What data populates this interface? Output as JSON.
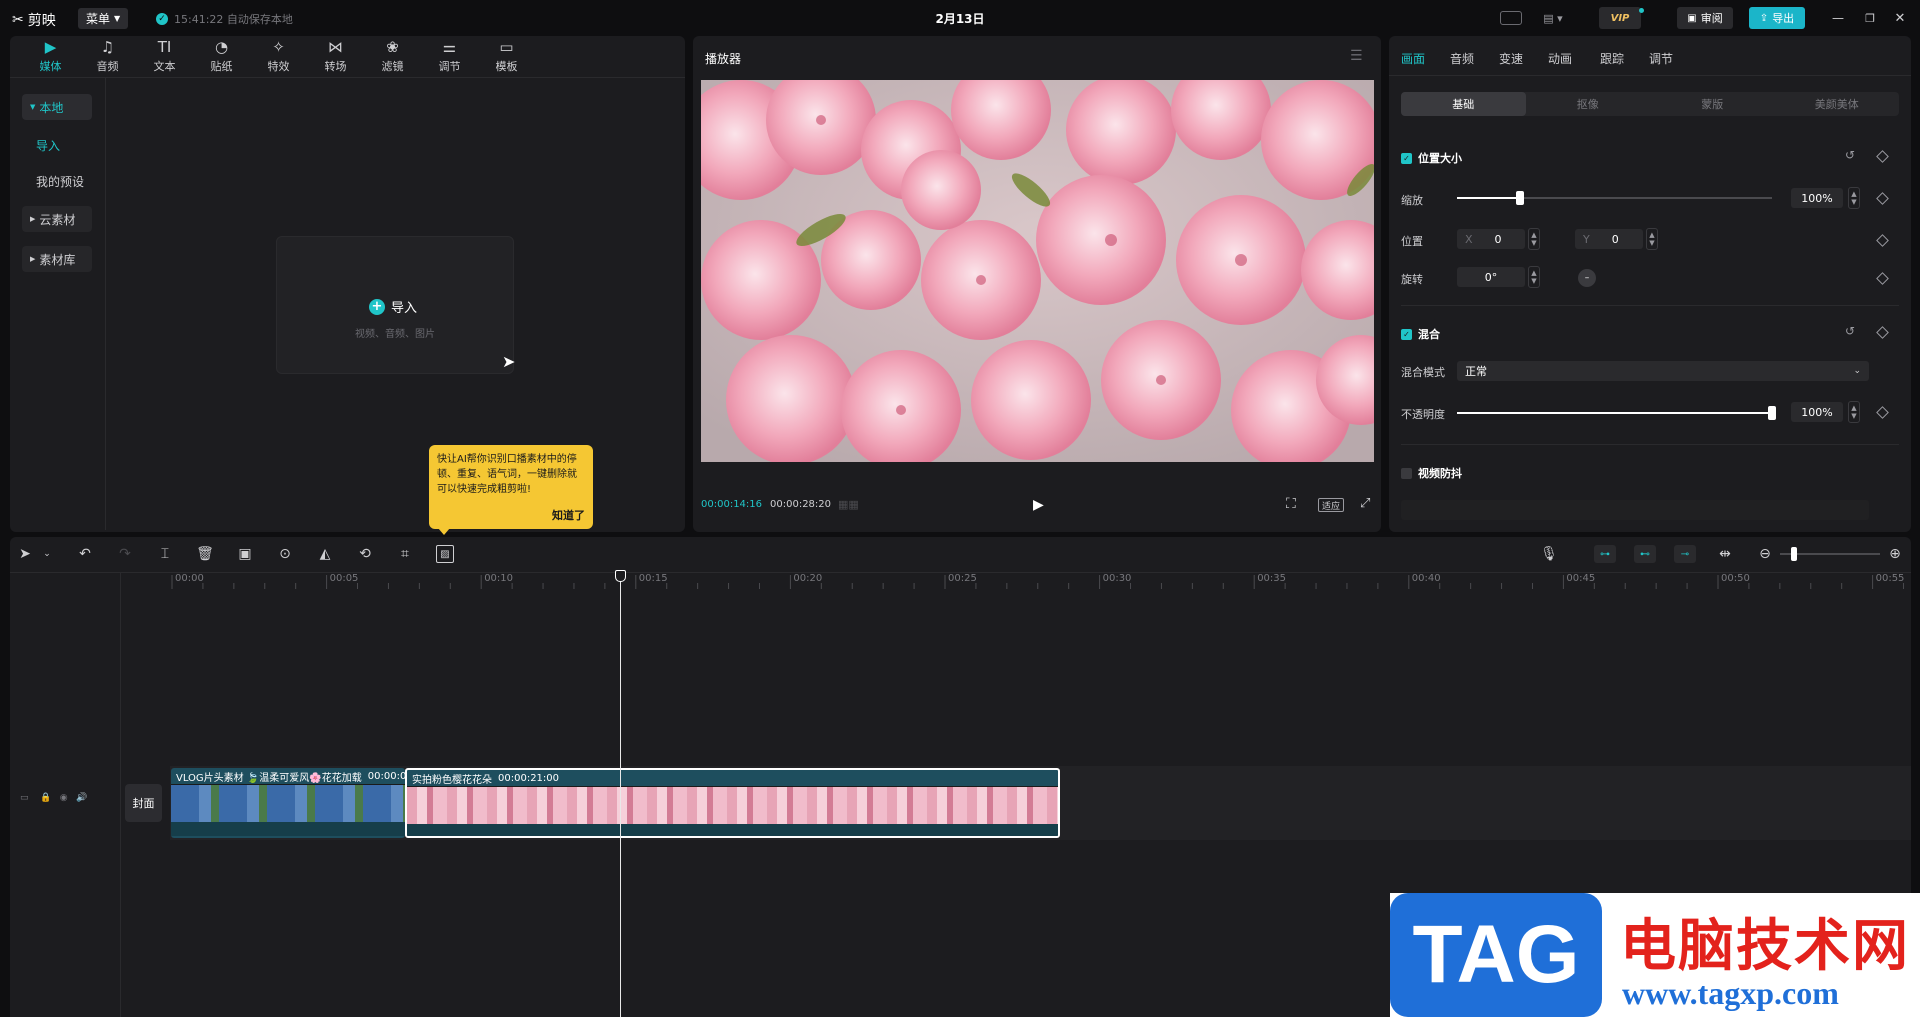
{
  "app": {
    "name": "剪映",
    "menu_label": "菜单",
    "autosave_text": "15:41:22 自动保存本地",
    "doc_title": "2月13日"
  },
  "titlebar": {
    "vip_label": "VIP",
    "review_label": "审阅",
    "export_label": "导出"
  },
  "media_tabs": [
    {
      "label": "媒体",
      "icon": "media-icon"
    },
    {
      "label": "音频",
      "icon": "audio-icon"
    },
    {
      "label": "文本",
      "icon": "text-icon"
    },
    {
      "label": "贴纸",
      "icon": "sticker-icon"
    },
    {
      "label": "特效",
      "icon": "effects-icon"
    },
    {
      "label": "转场",
      "icon": "transition-icon"
    },
    {
      "label": "滤镜",
      "icon": "filter-icon"
    },
    {
      "label": "调节",
      "icon": "adjust-icon"
    },
    {
      "label": "模板",
      "icon": "template-icon"
    }
  ],
  "sidebar": {
    "local": "本地",
    "import": "导入",
    "presets": "我的预设",
    "cloud": "云素材",
    "library": "素材库"
  },
  "import_box": {
    "label": "导入",
    "hint": "视频、音频、图片"
  },
  "tooltip": {
    "text": "快让AI帮你识别口播素材中的停顿、重复、语气词，一键删除就可以快速完成粗剪啦!",
    "button": "知道了"
  },
  "player": {
    "title": "播放器",
    "current_time": "00:00:14:16",
    "total_time": "00:00:28:20",
    "ratio_label": "适应"
  },
  "props": {
    "tabs": [
      "画面",
      "音频",
      "变速",
      "动画",
      "跟踪",
      "调节"
    ],
    "subtabs": [
      "基础",
      "抠像",
      "蒙版",
      "美颜美体"
    ],
    "position_size": {
      "title": "位置大小",
      "scale_label": "缩放",
      "scale_value": "100%",
      "scale_fraction": 0.2,
      "position_label": "位置",
      "x_label": "X",
      "x_value": "0",
      "y_label": "Y",
      "y_value": "0",
      "rotate_label": "旋转",
      "rotate_value": "0°"
    },
    "blend": {
      "title": "混合",
      "mode_label": "混合模式",
      "mode_value": "正常",
      "opacity_label": "不透明度",
      "opacity_value": "100%",
      "opacity_fraction": 1.0
    },
    "stabilize": {
      "title": "视频防抖"
    }
  },
  "timeline": {
    "ticks": [
      "00:00",
      "00:05",
      "00:10",
      "00:15",
      "00:20",
      "00:25",
      "00:30",
      "00:35",
      "00:40",
      "00:45",
      "00:50",
      "00:55"
    ],
    "cover_label": "封面",
    "clip1": {
      "title": "VLOG片头素材 🍃温柔可爱风🌸花花加载",
      "duration": "00:00:0"
    },
    "clip2": {
      "title": "实拍粉色樱花花朵",
      "duration": "00:00:21:00"
    }
  },
  "colors": {
    "accent": "#20c5c8",
    "tooltip": "#f5c733",
    "export": "#1bb5c9",
    "clip": "#1e4e5e"
  },
  "watermark": {
    "tag": "TAG",
    "site_name": "电脑技术网",
    "url": "www.tagxp.com"
  }
}
